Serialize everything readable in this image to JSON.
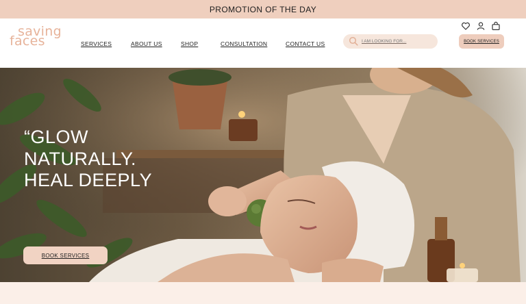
{
  "promo": {
    "text": "PROMOTION OF THE DAY"
  },
  "logo": {
    "line1": "saving",
    "line2": "faces"
  },
  "nav": {
    "items": [
      {
        "label": "SERVICES"
      },
      {
        "label": "ABOUT US"
      },
      {
        "label": "SHOP"
      },
      {
        "label": "CONSULTATION"
      },
      {
        "label": "CONTACT US"
      }
    ]
  },
  "search": {
    "placeholder": "I AM LOOKING FOR..."
  },
  "header_icons": [
    "heart-icon",
    "user-icon",
    "bag-icon"
  ],
  "header_button": {
    "label": "BOOK SERVICES"
  },
  "hero": {
    "headline": [
      "“GLOW",
      "NATURALLY.",
      "HEAL DEEPLY"
    ],
    "button": "BOOK SERVICES"
  },
  "colors": {
    "promo_bg": "#efcfbe",
    "accent": "#e7b39a",
    "button_bg": "#eecdbd",
    "page_bg": "#fbefe8"
  }
}
